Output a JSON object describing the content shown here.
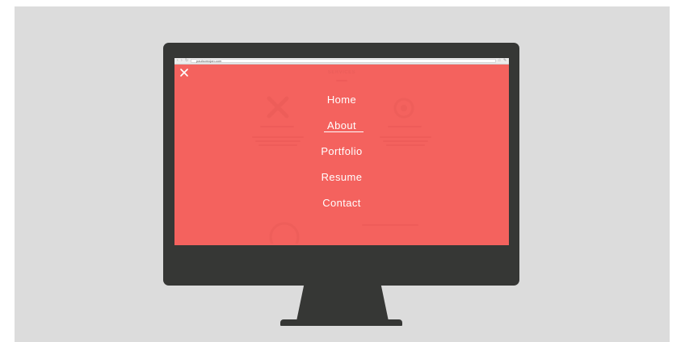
{
  "browser": {
    "url": "paulsomojan.com",
    "back_icon": "back-arrow-icon",
    "forward_icon": "forward-arrow-icon",
    "reload_icon": "reload-icon",
    "star_icon": "star-icon",
    "settings_icon": "wrench-icon"
  },
  "overlay": {
    "close_icon": "close-icon",
    "background_color": "#f4625e",
    "text_color": "#ffffff"
  },
  "page_behind": {
    "heading": "SERVICES"
  },
  "menu": {
    "items": [
      {
        "label": "Home"
      },
      {
        "label": "About",
        "active": true
      },
      {
        "label": "Portfolio"
      },
      {
        "label": "Resume"
      },
      {
        "label": "Contact"
      }
    ]
  },
  "device": {
    "frame_color": "#363735",
    "backdrop_color": "#dcdcdc"
  }
}
